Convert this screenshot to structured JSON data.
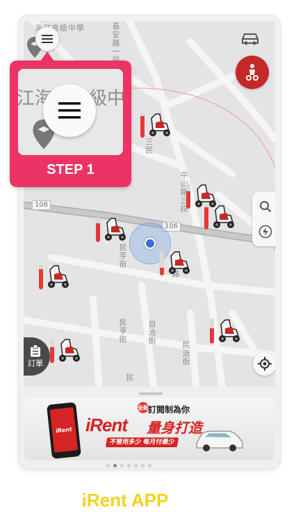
{
  "map": {
    "school_label": "海汀高級中學",
    "road_top": "長安路一段",
    "road_sanmin": "三民",
    "road_zhongshan": "中山路三段",
    "road_minheng": "民亨街",
    "road_minheng2": "民亨街",
    "road_zizhi": "自治街",
    "road_minzhi": "民治街",
    "road_minzhi2": "民治路",
    "road_min": "民",
    "route_106_a": "106",
    "route_106_b": "106",
    "scooter_batteries": [
      0.85,
      0.7,
      0.9,
      0.75,
      0.8,
      0.3,
      0.6,
      0.65,
      0.5
    ]
  },
  "controls": {
    "order_label": "訂單",
    "menu_icon": "hamburger-icon",
    "car_icon": "car-icon",
    "scooter_icon": "scooter-icon",
    "search_icon": "search-icon",
    "charge_icon": "lightning-icon",
    "gps_icon": "crosshair-icon"
  },
  "banner": {
    "new_badge": "全新",
    "top_text": "訂閱制為你",
    "brand": "iRent",
    "brand_sub": "量身打造",
    "promo": "不管用多少 每月付最少",
    "phone_brand": "iRent",
    "active_dot": 1,
    "dot_count": 7
  },
  "callout": {
    "zoom_text": "江海汀高級中",
    "step_label": "STEP 1"
  },
  "caption": "iRent APP",
  "colors": {
    "accent_pink": "#ec3366",
    "brand_red": "#c62828",
    "caption_yellow": "#f4d21f",
    "locate_blue": "#3b6fd8"
  }
}
